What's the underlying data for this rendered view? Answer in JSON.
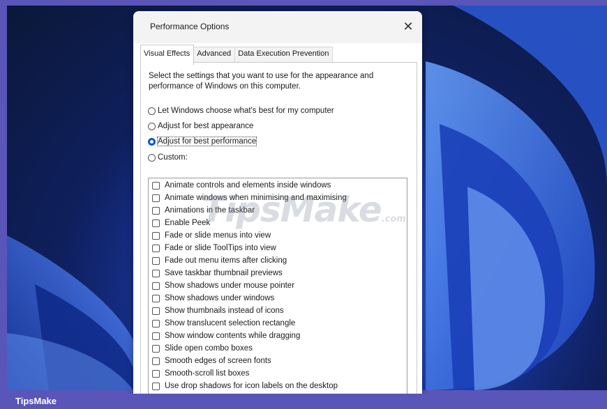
{
  "dialog": {
    "title": "Performance Options",
    "close_glyph": "✕",
    "tabs": [
      {
        "label": "Visual Effects",
        "active": true
      },
      {
        "label": "Advanced",
        "active": false
      },
      {
        "label": "Data Execution Prevention",
        "active": false
      }
    ],
    "description": "Select the settings that you want to use for the appearance and performance of Windows on this computer.",
    "radios": [
      {
        "label": "Let Windows choose what's best for my computer",
        "selected": false
      },
      {
        "label": "Adjust for best appearance",
        "selected": false
      },
      {
        "label": "Adjust for best performance",
        "selected": true
      },
      {
        "label": "Custom:",
        "selected": false
      }
    ],
    "effects": [
      {
        "label": "Animate controls and elements inside windows",
        "checked": false
      },
      {
        "label": "Animate windows when minimising and maximising",
        "checked": false
      },
      {
        "label": "Animations in the taskbar",
        "checked": false
      },
      {
        "label": "Enable Peek",
        "checked": false
      },
      {
        "label": "Fade or slide menus into view",
        "checked": false
      },
      {
        "label": "Fade or slide ToolTips into view",
        "checked": false
      },
      {
        "label": "Fade out menu items after clicking",
        "checked": false
      },
      {
        "label": "Save taskbar thumbnail previews",
        "checked": false
      },
      {
        "label": "Show shadows under mouse pointer",
        "checked": false
      },
      {
        "label": "Show shadows under windows",
        "checked": false
      },
      {
        "label": "Show thumbnails instead of icons",
        "checked": false
      },
      {
        "label": "Show translucent selection rectangle",
        "checked": false
      },
      {
        "label": "Show window contents while dragging",
        "checked": false
      },
      {
        "label": "Slide open combo boxes",
        "checked": false
      },
      {
        "label": "Smooth edges of screen fonts",
        "checked": false
      },
      {
        "label": "Smooth-scroll list boxes",
        "checked": false
      },
      {
        "label": "Use drop shadows for icon labels on the desktop",
        "checked": false
      }
    ]
  },
  "watermark": {
    "main": "TipsMake",
    "suffix": ".com"
  },
  "footer": {
    "brand": "TipsMake"
  },
  "colors": {
    "accent": "#0a5bc4",
    "frame": "#5a55b8"
  }
}
